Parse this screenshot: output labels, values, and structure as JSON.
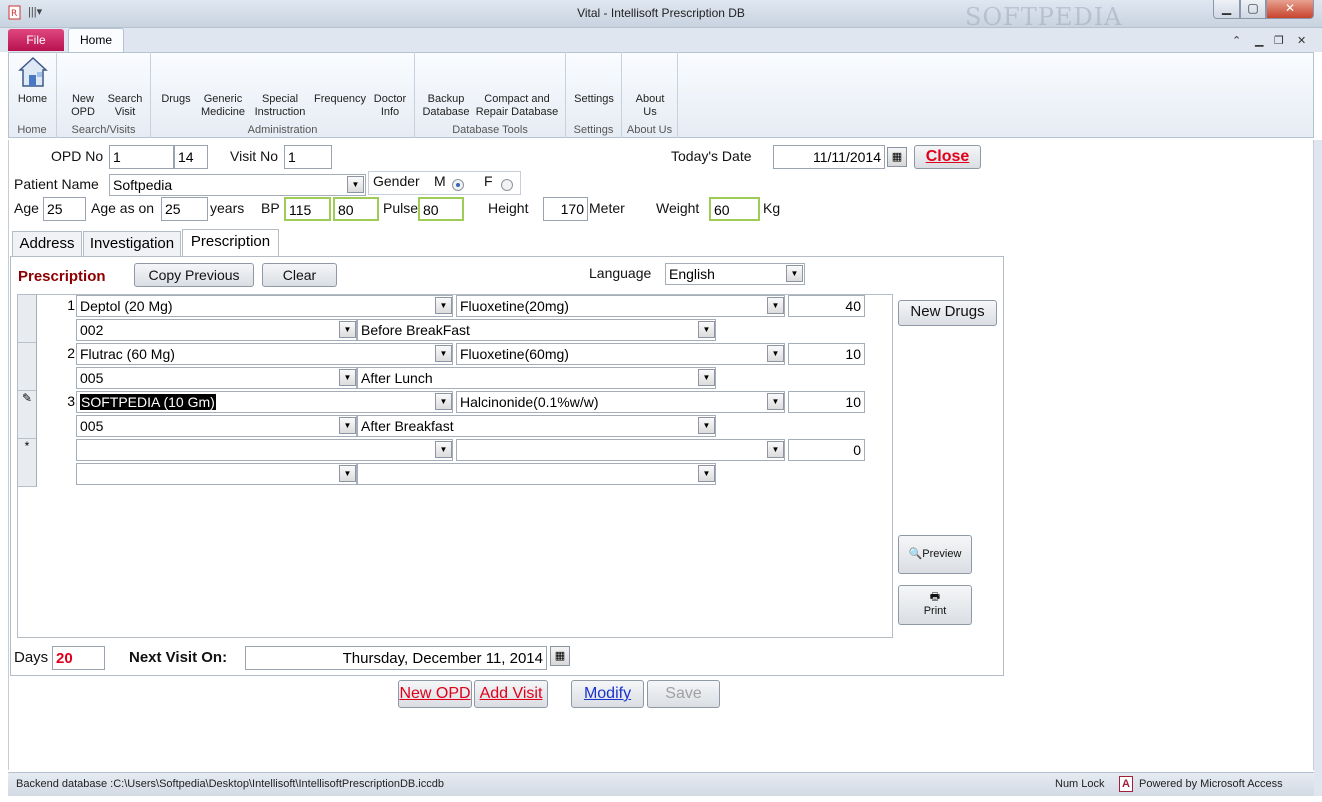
{
  "window": {
    "title": "Vital  -  Intellisoft Prescription DB",
    "watermark": "SOFTPEDIA"
  },
  "ribbon": {
    "tabs": [
      "File",
      "Home"
    ],
    "groups": [
      {
        "label": "Home",
        "buttons": [
          [
            "Home"
          ]
        ]
      },
      {
        "label": "Search/Visits",
        "buttons": [
          [
            "New",
            "OPD"
          ],
          [
            "Search",
            "Visit"
          ]
        ]
      },
      {
        "label": "Administration",
        "buttons": [
          [
            "Drugs"
          ],
          [
            "Generic",
            "Medicine"
          ],
          [
            "Special",
            "Instruction"
          ],
          [
            "Frequency"
          ],
          [
            "Doctor",
            "Info"
          ]
        ]
      },
      {
        "label": "Database Tools",
        "buttons": [
          [
            "Backup",
            "Database"
          ],
          [
            "Compact and",
            "Repair Database"
          ]
        ]
      },
      {
        "label": "Settings",
        "buttons": [
          [
            "Settings"
          ]
        ]
      },
      {
        "label": "About Us",
        "buttons": [
          [
            "About",
            "Us"
          ]
        ]
      }
    ]
  },
  "form": {
    "opd_label": "OPD No",
    "opd_no": "1",
    "opd_no2": "14",
    "visit_label": "Visit No",
    "visit_no": "1",
    "date_label": "Today's Date",
    "today": "11/11/2014",
    "close_label": "Close",
    "patient_label": "Patient Name",
    "patient_name": "Softpedia",
    "gender_label": "Gender",
    "gender_m": "M",
    "gender_f": "F",
    "age_label": "Age",
    "age": "25",
    "age_as_on_label": "Age as on",
    "age_as_on": "25",
    "years_label": "years",
    "bp_label": "BP",
    "bp_sys": "115",
    "bp_dia": "80",
    "pulse_label": "Pulse",
    "pulse": "80",
    "height_label": "Height",
    "height": "170",
    "height_unit": "Meter",
    "weight_label": "Weight",
    "weight": "60",
    "weight_unit": "Kg"
  },
  "tabs": [
    "Address",
    "Investigation",
    "Prescription"
  ],
  "prescription": {
    "heading": "Prescription",
    "copy_previous": "Copy Previous",
    "clear": "Clear",
    "language_label": "Language",
    "language": "English",
    "new_drugs": "New Drugs",
    "preview": "Preview",
    "print": "Print",
    "rows": [
      {
        "num": "1",
        "drug": "Deptol (20 Mg)",
        "generic": "Fluoxetine(20mg)",
        "qty": "40",
        "code": "002",
        "instruction": "Before  BreakFast",
        "marker": ""
      },
      {
        "num": "2",
        "drug": "Flutrac (60 Mg)",
        "generic": "Fluoxetine(60mg)",
        "qty": "10",
        "code": "005",
        "instruction": "After Lunch",
        "marker": ""
      },
      {
        "num": "3",
        "drug": "SOFTPEDIA (10 Gm)",
        "generic": "Halcinonide(0.1%w/w)",
        "qty": "10",
        "code": "005",
        "instruction": "After Breakfast",
        "marker": "✎"
      },
      {
        "num": "",
        "drug": "",
        "generic": "",
        "qty": "0",
        "code": "",
        "instruction": "",
        "marker": "*"
      }
    ],
    "days_label": "Days",
    "days": "20",
    "next_visit_label": "Next Visit On:",
    "next_visit": "Thursday, December 11, 2014"
  },
  "actions": {
    "new_opd": "New OPD",
    "add_visit": "Add Visit",
    "modify": "Modify",
    "save": "Save"
  },
  "status": {
    "backend": "Backend database :C:\\Users\\Softpedia\\Desktop\\Intellisoft\\IntellisoftPrescriptionDB.iccdb",
    "numlock": "Num Lock",
    "powered": "Powered by Microsoft Access",
    "access_logo": "A"
  },
  "colors": {
    "file_tab": "#c2185b",
    "close_text": "#e0001a",
    "heading": "#8b0000",
    "days_value": "#e0001a",
    "green_border": "#9ecc57"
  }
}
